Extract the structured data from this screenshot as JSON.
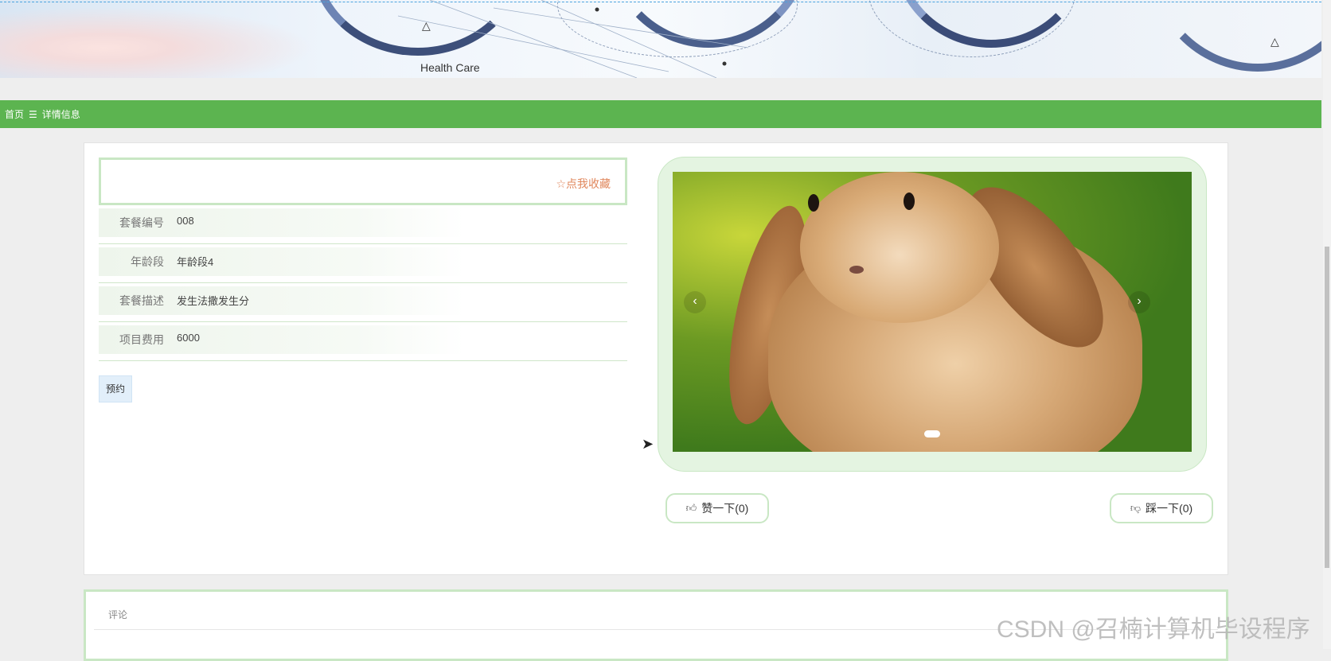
{
  "banner": {
    "caption": "Health Care"
  },
  "breadcrumb": {
    "home": "首页",
    "separator": "☰",
    "current": "详情信息"
  },
  "detail": {
    "favorite_label": "点我收藏",
    "fields": [
      {
        "label": "套餐编号",
        "value": "008"
      },
      {
        "label": "年龄段",
        "value": "年龄段4"
      },
      {
        "label": "套餐描述",
        "value": "发生法撒发生分"
      },
      {
        "label": "项目费用",
        "value": "6000"
      }
    ],
    "book_button": "预约"
  },
  "carousel": {
    "prev": "‹",
    "next": "›",
    "slide_count": 1,
    "active_index": 0
  },
  "votes": {
    "like_label": "赞一下(0)",
    "dislike_label": "踩一下(0)"
  },
  "comments": {
    "label": "评论"
  },
  "watermark": "CSDN @召楠计算机毕设程序",
  "colors": {
    "accent_green": "#5cb450",
    "border_green": "#c9e7c4",
    "favorite_orange": "#e0875c"
  },
  "icons": [
    "star-icon",
    "thumbs-up-icon",
    "thumbs-down-icon",
    "chevron-left-icon",
    "chevron-right-icon",
    "menu-icon",
    "mouse-cursor-icon"
  ]
}
